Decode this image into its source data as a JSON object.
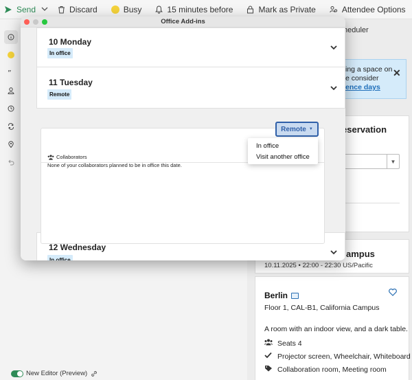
{
  "toolbar": {
    "send": "Send",
    "discard": "Discard",
    "busy": "Busy",
    "reminder": "15 minutes before",
    "private": "Mark as Private",
    "attendee": "Attendee Options",
    "more": "…"
  },
  "dialog": {
    "title": "Office Add-ins",
    "days": [
      {
        "name": "10 Monday",
        "status": "In office"
      },
      {
        "name": "11 Tuesday",
        "status": "Remote"
      },
      {
        "name": "12 Wednesday",
        "status": "In office"
      }
    ],
    "detail": {
      "remote_button": "Remote",
      "collaborators_label": "Collaborators",
      "collaborators_text": "None of your collaborators planned to be in office this date."
    },
    "menu": [
      "In office",
      "Visit another office"
    ]
  },
  "right": {
    "scheduler_tab": "heduler",
    "info_line1": "ing a space on",
    "info_line2": "e consider",
    "info_link": "ence days",
    "reservation_title": "eservation",
    "campus_title": "ampus",
    "campus_time": "10.11.2025 • 22:00 - 22:30 US/Pacific",
    "room": {
      "name": "Berlin",
      "floor": "Floor 1, CAL-B1, California Campus",
      "description": "A room with an indoor view, and a dark table.",
      "seats": "Seats 4",
      "equipment": "Projector screen, Wheelchair, Whiteboard",
      "tags": "Collaboration room, Meeting room"
    }
  },
  "footer": {
    "editor_label": "New Editor (Preview)"
  },
  "colors": {
    "accent": "#2f5fa8",
    "send": "#2e8b57",
    "badge_bg": "#d5ebfa",
    "busy": "#f5d33b"
  }
}
